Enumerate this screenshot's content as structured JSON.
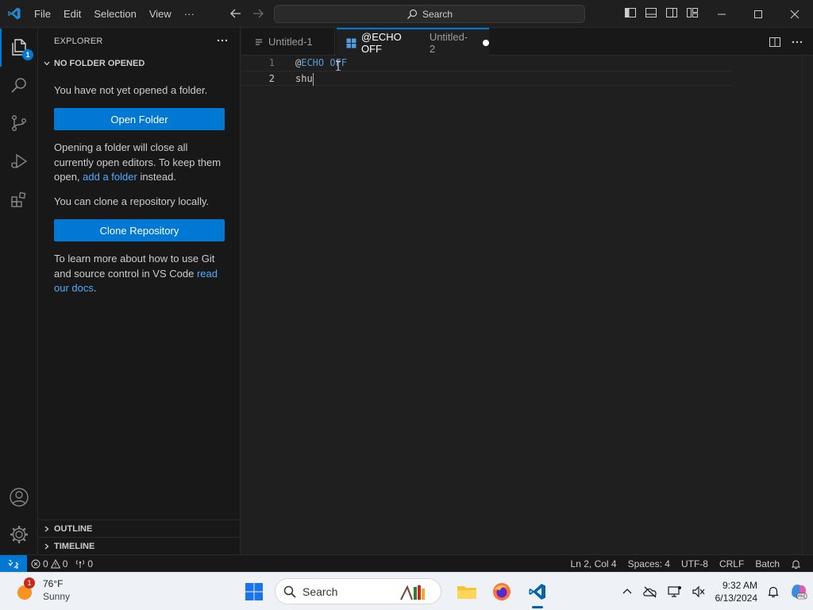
{
  "titlebar": {
    "menu": [
      "File",
      "Edit",
      "Selection",
      "View",
      "···"
    ],
    "search_label": "Search"
  },
  "activity_bar": {
    "explorer_badge": "1",
    "items": [
      "files-icon",
      "search-icon",
      "source-control-icon",
      "run-debug-icon",
      "extensions-icon",
      "accounts-icon",
      "manage-gear-icon"
    ]
  },
  "sidebar": {
    "header": "EXPLORER",
    "more": "···",
    "section_title": "NO FOLDER OPENED",
    "no_folder_text": "You have not yet opened a folder.",
    "open_folder_button": "Open Folder",
    "warning_prefix": "Opening a folder will close all currently open editors. To keep them open, ",
    "warning_link": "add a folder",
    "warning_suffix": " instead.",
    "clone_text": "You can clone a repository locally.",
    "clone_button": "Clone Repository",
    "learn_prefix": "To learn more about how to use Git and source control in VS Code ",
    "learn_link": "read our docs",
    "learn_suffix": ".",
    "outline": "OUTLINE",
    "timeline": "TIMELINE"
  },
  "tabs": [
    {
      "label": "Untitled-1",
      "active": false
    },
    {
      "label": "@ECHO OFF",
      "description": "Untitled-2",
      "active": true,
      "dirty": true
    }
  ],
  "editor": {
    "lines": [
      {
        "number": "1",
        "at": "@",
        "keyword": "ECHO OFF",
        "text": ""
      },
      {
        "number": "2",
        "at": "",
        "keyword": "",
        "text": "shu"
      }
    ],
    "keyword_color": "#569cd6"
  },
  "statusbar": {
    "errors": "0",
    "warnings": "0",
    "ports": "0",
    "position": "Ln 2, Col 4",
    "spaces": "Spaces: 4",
    "encoding": "UTF-8",
    "eol": "CRLF",
    "language": "Batch"
  },
  "taskbar": {
    "weather_badge": "1",
    "temperature": "76°F",
    "condition": "Sunny",
    "search_label": "Search",
    "time": "9:32 AM",
    "date": "6/13/2024"
  },
  "colors": {
    "accent": "#0078d4",
    "link": "#4daafc",
    "background": "#1f1f1f",
    "sidebar": "#181818"
  }
}
